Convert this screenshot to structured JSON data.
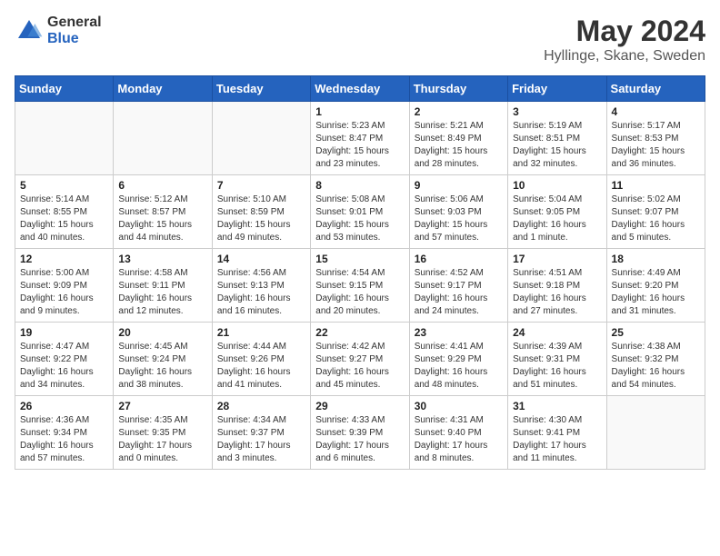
{
  "header": {
    "logo": {
      "general": "General",
      "blue": "Blue"
    },
    "title": "May 2024",
    "location": "Hyllinge, Skane, Sweden"
  },
  "calendar": {
    "days_of_week": [
      "Sunday",
      "Monday",
      "Tuesday",
      "Wednesday",
      "Thursday",
      "Friday",
      "Saturday"
    ],
    "weeks": [
      [
        {
          "day": "",
          "info": ""
        },
        {
          "day": "",
          "info": ""
        },
        {
          "day": "",
          "info": ""
        },
        {
          "day": "1",
          "info": "Sunrise: 5:23 AM\nSunset: 8:47 PM\nDaylight: 15 hours\nand 23 minutes."
        },
        {
          "day": "2",
          "info": "Sunrise: 5:21 AM\nSunset: 8:49 PM\nDaylight: 15 hours\nand 28 minutes."
        },
        {
          "day": "3",
          "info": "Sunrise: 5:19 AM\nSunset: 8:51 PM\nDaylight: 15 hours\nand 32 minutes."
        },
        {
          "day": "4",
          "info": "Sunrise: 5:17 AM\nSunset: 8:53 PM\nDaylight: 15 hours\nand 36 minutes."
        }
      ],
      [
        {
          "day": "5",
          "info": "Sunrise: 5:14 AM\nSunset: 8:55 PM\nDaylight: 15 hours\nand 40 minutes."
        },
        {
          "day": "6",
          "info": "Sunrise: 5:12 AM\nSunset: 8:57 PM\nDaylight: 15 hours\nand 44 minutes."
        },
        {
          "day": "7",
          "info": "Sunrise: 5:10 AM\nSunset: 8:59 PM\nDaylight: 15 hours\nand 49 minutes."
        },
        {
          "day": "8",
          "info": "Sunrise: 5:08 AM\nSunset: 9:01 PM\nDaylight: 15 hours\nand 53 minutes."
        },
        {
          "day": "9",
          "info": "Sunrise: 5:06 AM\nSunset: 9:03 PM\nDaylight: 15 hours\nand 57 minutes."
        },
        {
          "day": "10",
          "info": "Sunrise: 5:04 AM\nSunset: 9:05 PM\nDaylight: 16 hours\nand 1 minute."
        },
        {
          "day": "11",
          "info": "Sunrise: 5:02 AM\nSunset: 9:07 PM\nDaylight: 16 hours\nand 5 minutes."
        }
      ],
      [
        {
          "day": "12",
          "info": "Sunrise: 5:00 AM\nSunset: 9:09 PM\nDaylight: 16 hours\nand 9 minutes."
        },
        {
          "day": "13",
          "info": "Sunrise: 4:58 AM\nSunset: 9:11 PM\nDaylight: 16 hours\nand 12 minutes."
        },
        {
          "day": "14",
          "info": "Sunrise: 4:56 AM\nSunset: 9:13 PM\nDaylight: 16 hours\nand 16 minutes."
        },
        {
          "day": "15",
          "info": "Sunrise: 4:54 AM\nSunset: 9:15 PM\nDaylight: 16 hours\nand 20 minutes."
        },
        {
          "day": "16",
          "info": "Sunrise: 4:52 AM\nSunset: 9:17 PM\nDaylight: 16 hours\nand 24 minutes."
        },
        {
          "day": "17",
          "info": "Sunrise: 4:51 AM\nSunset: 9:18 PM\nDaylight: 16 hours\nand 27 minutes."
        },
        {
          "day": "18",
          "info": "Sunrise: 4:49 AM\nSunset: 9:20 PM\nDaylight: 16 hours\nand 31 minutes."
        }
      ],
      [
        {
          "day": "19",
          "info": "Sunrise: 4:47 AM\nSunset: 9:22 PM\nDaylight: 16 hours\nand 34 minutes."
        },
        {
          "day": "20",
          "info": "Sunrise: 4:45 AM\nSunset: 9:24 PM\nDaylight: 16 hours\nand 38 minutes."
        },
        {
          "day": "21",
          "info": "Sunrise: 4:44 AM\nSunset: 9:26 PM\nDaylight: 16 hours\nand 41 minutes."
        },
        {
          "day": "22",
          "info": "Sunrise: 4:42 AM\nSunset: 9:27 PM\nDaylight: 16 hours\nand 45 minutes."
        },
        {
          "day": "23",
          "info": "Sunrise: 4:41 AM\nSunset: 9:29 PM\nDaylight: 16 hours\nand 48 minutes."
        },
        {
          "day": "24",
          "info": "Sunrise: 4:39 AM\nSunset: 9:31 PM\nDaylight: 16 hours\nand 51 minutes."
        },
        {
          "day": "25",
          "info": "Sunrise: 4:38 AM\nSunset: 9:32 PM\nDaylight: 16 hours\nand 54 minutes."
        }
      ],
      [
        {
          "day": "26",
          "info": "Sunrise: 4:36 AM\nSunset: 9:34 PM\nDaylight: 16 hours\nand 57 minutes."
        },
        {
          "day": "27",
          "info": "Sunrise: 4:35 AM\nSunset: 9:35 PM\nDaylight: 17 hours\nand 0 minutes."
        },
        {
          "day": "28",
          "info": "Sunrise: 4:34 AM\nSunset: 9:37 PM\nDaylight: 17 hours\nand 3 minutes."
        },
        {
          "day": "29",
          "info": "Sunrise: 4:33 AM\nSunset: 9:39 PM\nDaylight: 17 hours\nand 6 minutes."
        },
        {
          "day": "30",
          "info": "Sunrise: 4:31 AM\nSunset: 9:40 PM\nDaylight: 17 hours\nand 8 minutes."
        },
        {
          "day": "31",
          "info": "Sunrise: 4:30 AM\nSunset: 9:41 PM\nDaylight: 17 hours\nand 11 minutes."
        },
        {
          "day": "",
          "info": ""
        }
      ]
    ]
  }
}
